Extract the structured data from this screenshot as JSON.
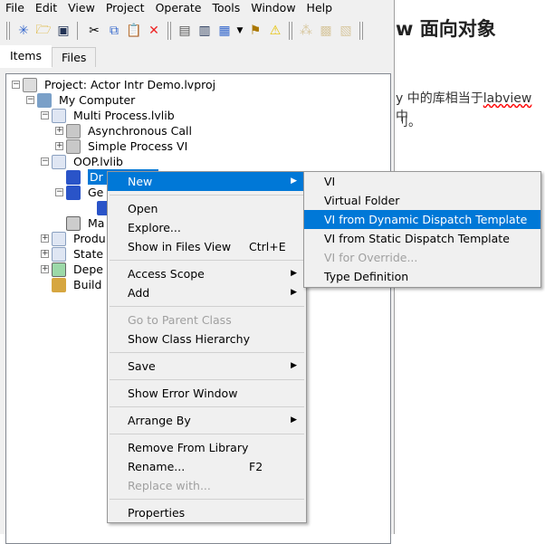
{
  "menubar": [
    "File",
    "Edit",
    "View",
    "Project",
    "Operate",
    "Tools",
    "Window",
    "Help"
  ],
  "tabs": [
    "Items",
    "Files"
  ],
  "tree": [
    {
      "label": "Project: Actor Intr Demo.lvproj",
      "expander": "-",
      "icon": "project-icon"
    },
    {
      "label": "My Computer",
      "expander": "-",
      "icon": "computer-icon"
    },
    {
      "label": "Multi Process.lvlib",
      "expander": "-",
      "icon": "library-icon"
    },
    {
      "label": "Asynchronous Call",
      "expander": "+",
      "icon": "folder-icon"
    },
    {
      "label": "Simple Process VI",
      "expander": "+",
      "icon": "folder-icon"
    },
    {
      "label": "OOP.lvlib",
      "expander": "-",
      "icon": "library-icon"
    },
    {
      "label": "Dr",
      "expander": "",
      "icon": "class-icon"
    },
    {
      "label": "Ge",
      "expander": "-",
      "icon": "class-icon"
    },
    {
      "label": "",
      "expander": "",
      "icon": "class-private-icon"
    },
    {
      "label": "Ma",
      "expander": "",
      "icon": "vi-icon"
    },
    {
      "label": "Produ",
      "expander": "+",
      "icon": "library-icon"
    },
    {
      "label": "State",
      "expander": "+",
      "icon": "library-icon"
    },
    {
      "label": "Depe",
      "expander": "+",
      "icon": "dependencies-icon"
    },
    {
      "label": "Build",
      "expander": "",
      "icon": "build-icon"
    }
  ],
  "context_menu": [
    {
      "label": "New",
      "submenu": true,
      "highlighted": true
    },
    {
      "sep": true
    },
    {
      "label": "Open"
    },
    {
      "label": "Explore..."
    },
    {
      "label": "Show in Files View",
      "shortcut": "Ctrl+E"
    },
    {
      "sep": true
    },
    {
      "label": "Access Scope",
      "submenu": true
    },
    {
      "label": "Add",
      "submenu": true
    },
    {
      "sep": true
    },
    {
      "label": "Go to Parent Class",
      "disabled": true
    },
    {
      "label": "Show Class Hierarchy"
    },
    {
      "sep": true
    },
    {
      "label": "Save",
      "submenu": true
    },
    {
      "sep": true
    },
    {
      "label": "Show Error Window"
    },
    {
      "sep": true
    },
    {
      "label": "Arrange By",
      "submenu": true
    },
    {
      "sep": true
    },
    {
      "label": "Remove From Library"
    },
    {
      "label": "Rename...",
      "shortcut": "F2"
    },
    {
      "label": "Replace with...",
      "disabled": true
    },
    {
      "sep": true
    },
    {
      "label": "Properties"
    }
  ],
  "submenu": [
    {
      "label": "VI"
    },
    {
      "label": "Virtual Folder"
    },
    {
      "label": "VI from Dynamic Dispatch Template",
      "highlighted": true
    },
    {
      "label": "VI from Static Dispatch Template"
    },
    {
      "label": "VI for Override...",
      "disabled": true
    },
    {
      "label": "Type Definition"
    }
  ],
  "doc": {
    "heading": "w 面向对象",
    "line1a": "y 中的库相当于",
    "line1b": "labview",
    "line1c": " 中",
    "line2": "刂。"
  },
  "colors": {
    "highlight": "#0078d7",
    "menu_bg": "#f0f0f0"
  }
}
